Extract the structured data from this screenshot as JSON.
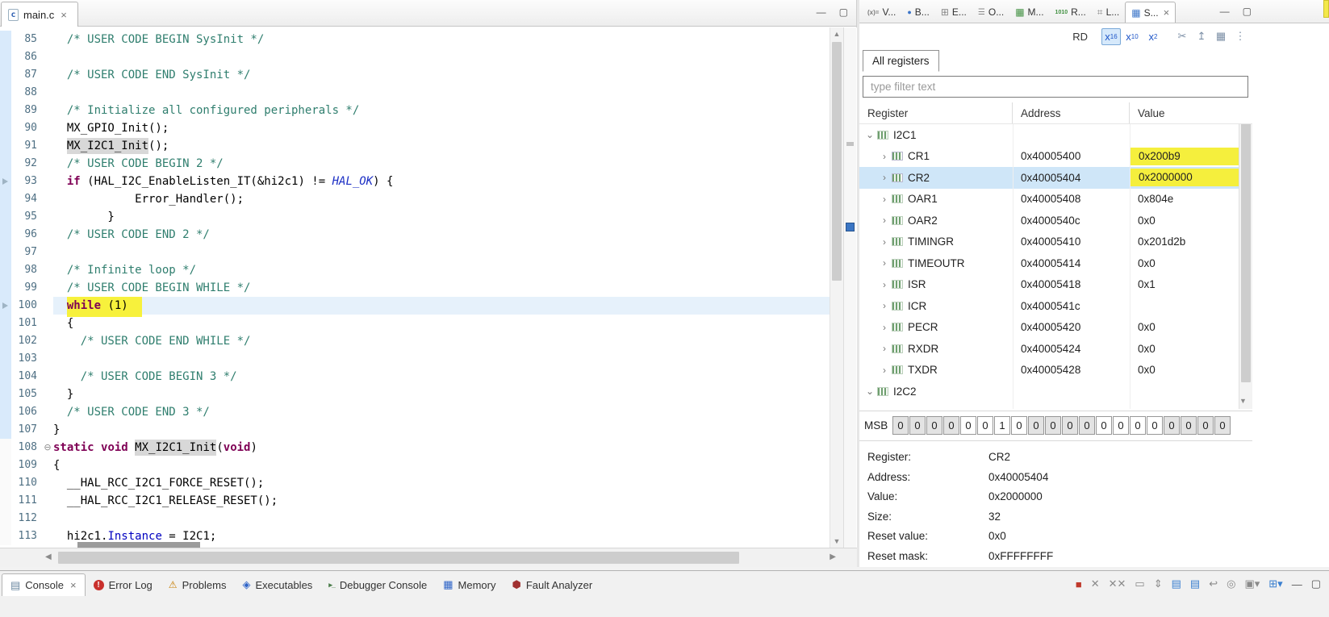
{
  "editor": {
    "tab_title": "main.c",
    "close_glyph": "×",
    "current_line": 100,
    "range_end_line": 107,
    "marker_lines": [
      93,
      100
    ],
    "lines": [
      {
        "n": 85,
        "segs": [
          {
            "t": "  /* USER CODE BEGIN SysInit */",
            "c": "cm"
          }
        ]
      },
      {
        "n": 86,
        "segs": []
      },
      {
        "n": 87,
        "segs": [
          {
            "t": "  /* USER CODE END SysInit */",
            "c": "cm"
          }
        ]
      },
      {
        "n": 88,
        "segs": []
      },
      {
        "n": 89,
        "segs": [
          {
            "t": "  /* Initialize all configured peripherals */",
            "c": "cm"
          }
        ]
      },
      {
        "n": 90,
        "segs": [
          {
            "t": "  MX_GPIO_Init();",
            "c": "pl"
          }
        ]
      },
      {
        "n": 91,
        "segs": [
          {
            "t": "  ",
            "c": "pl"
          },
          {
            "t": "MX_I2C1_Init",
            "c": "pl occ"
          },
          {
            "t": "();",
            "c": "pl"
          }
        ]
      },
      {
        "n": 92,
        "segs": [
          {
            "t": "  /* USER CODE BEGIN 2 */",
            "c": "cm"
          }
        ]
      },
      {
        "n": 93,
        "segs": [
          {
            "t": "  ",
            "c": "pl"
          },
          {
            "t": "if",
            "c": "kw"
          },
          {
            "t": " (HAL_I2C_EnableListen_IT(&hi2c1) != ",
            "c": "pl"
          },
          {
            "t": "HAL_OK",
            "c": "mac"
          },
          {
            "t": ") {",
            "c": "pl"
          }
        ]
      },
      {
        "n": 94,
        "segs": [
          {
            "t": "            Error_Handler();",
            "c": "pl"
          }
        ]
      },
      {
        "n": 95,
        "segs": [
          {
            "t": "        }",
            "c": "pl"
          }
        ]
      },
      {
        "n": 96,
        "segs": [
          {
            "t": "  /* USER CODE END 2 */",
            "c": "cm"
          }
        ]
      },
      {
        "n": 97,
        "segs": []
      },
      {
        "n": 98,
        "segs": [
          {
            "t": "  /* Infinite loop */",
            "c": "cm"
          }
        ]
      },
      {
        "n": 99,
        "segs": [
          {
            "t": "  /* USER CODE BEGIN WHILE */",
            "c": "cm"
          }
        ]
      },
      {
        "n": 100,
        "segs": [
          {
            "t": "  ",
            "c": "pl"
          },
          {
            "t": "while",
            "c": "kw hl"
          },
          {
            "t": " (1)  ",
            "c": "pl hl"
          }
        ]
      },
      {
        "n": 101,
        "segs": [
          {
            "t": "  {",
            "c": "pl"
          }
        ]
      },
      {
        "n": 102,
        "segs": [
          {
            "t": "    /* USER CODE END WHILE */",
            "c": "cm"
          }
        ]
      },
      {
        "n": 103,
        "segs": []
      },
      {
        "n": 104,
        "segs": [
          {
            "t": "    /* USER CODE BEGIN 3 */",
            "c": "cm"
          }
        ]
      },
      {
        "n": 105,
        "segs": [
          {
            "t": "  }",
            "c": "pl"
          }
        ]
      },
      {
        "n": 106,
        "segs": [
          {
            "t": "  /* USER CODE END 3 */",
            "c": "cm"
          }
        ]
      },
      {
        "n": 107,
        "segs": [
          {
            "t": "}",
            "c": "pl"
          }
        ]
      },
      {
        "n": 108,
        "fold": true,
        "segs": [
          {
            "t": "static",
            "c": "kw"
          },
          {
            "t": " ",
            "c": "pl"
          },
          {
            "t": "void",
            "c": "kw"
          },
          {
            "t": " ",
            "c": "pl"
          },
          {
            "t": "MX_I2C1_Init",
            "c": "pl occ"
          },
          {
            "t": "(",
            "c": "pl"
          },
          {
            "t": "void",
            "c": "kw"
          },
          {
            "t": ")",
            "c": "pl"
          }
        ]
      },
      {
        "n": 109,
        "segs": [
          {
            "t": "{",
            "c": "pl"
          }
        ]
      },
      {
        "n": 110,
        "segs": [
          {
            "t": "  __HAL_RCC_I2C1_FORCE_RESET();",
            "c": "pl"
          }
        ]
      },
      {
        "n": 111,
        "segs": [
          {
            "t": "  __HAL_RCC_I2C1_RELEASE_RESET();",
            "c": "pl"
          }
        ]
      },
      {
        "n": 112,
        "segs": []
      },
      {
        "n": 113,
        "segs": [
          {
            "t": "  hi2c1.",
            "c": "pl"
          },
          {
            "t": "Instance",
            "c": "fld"
          },
          {
            "t": " = I2C1;",
            "c": "pl"
          }
        ]
      }
    ]
  },
  "registers_panel": {
    "tabs": [
      {
        "label": "V...",
        "icon": "variables"
      },
      {
        "label": "B...",
        "icon": "breakpoints"
      },
      {
        "label": "E...",
        "icon": "expressions"
      },
      {
        "label": "O...",
        "icon": "outline"
      },
      {
        "label": "M...",
        "icon": "modules"
      },
      {
        "label": "R...",
        "icon": "registers"
      },
      {
        "label": "L...",
        "icon": "live-expressions"
      },
      {
        "label": "S...",
        "icon": "sfrs",
        "active": true,
        "close": "×"
      }
    ],
    "toolbar": {
      "access_label": "RD",
      "radix": [
        {
          "base": "16",
          "active": true
        },
        {
          "base": "10",
          "active": false
        },
        {
          "base": "2",
          "active": false
        }
      ],
      "icons": [
        {
          "name": "cut"
        },
        {
          "name": "export"
        },
        {
          "name": "layout"
        },
        {
          "name": "view-menu"
        }
      ]
    },
    "category_tab": "All registers",
    "filter_placeholder": "type filter text",
    "table": {
      "columns": [
        "Register",
        "Address",
        "Value"
      ],
      "rows": [
        {
          "group": true,
          "name": "I2C1",
          "expanded": true
        },
        {
          "name": "CR1",
          "addr": "0x40005400",
          "value": "0x200b9",
          "value_highlight": true,
          "rw": true
        },
        {
          "name": "CR2",
          "addr": "0x40005404",
          "value": "0x2000000",
          "value_highlight": true,
          "rw": true,
          "selected": true
        },
        {
          "name": "OAR1",
          "addr": "0x40005408",
          "value": "0x804e"
        },
        {
          "name": "OAR2",
          "addr": "0x4000540c",
          "value": "0x0"
        },
        {
          "name": "TIMINGR",
          "addr": "0x40005410",
          "value": "0x201d2b"
        },
        {
          "name": "TIMEOUTR",
          "addr": "0x40005414",
          "value": "0x0"
        },
        {
          "name": "ISR",
          "addr": "0x40005418",
          "value": "0x1"
        },
        {
          "name": "ICR",
          "addr": "0x4000541c",
          "value": ""
        },
        {
          "name": "PECR",
          "addr": "0x40005420",
          "value": "0x0"
        },
        {
          "name": "RXDR",
          "addr": "0x40005424",
          "value": "0x0"
        },
        {
          "name": "TXDR",
          "addr": "0x40005428",
          "value": "0x0"
        },
        {
          "group": true,
          "name": "I2C2",
          "expanded": true
        }
      ]
    },
    "bits": {
      "label": "MSB",
      "values": [
        0,
        0,
        0,
        0,
        0,
        0,
        1,
        0,
        0,
        0,
        0,
        0,
        0,
        0,
        0,
        0,
        0,
        0,
        0,
        0
      ]
    },
    "details": [
      {
        "label": "Register:",
        "value": "CR2"
      },
      {
        "label": "Address:",
        "value": "0x40005404"
      },
      {
        "label": "Value:",
        "value": "0x2000000"
      },
      {
        "label": "Size:",
        "value": "32"
      },
      {
        "label": "Reset value:",
        "value": "0x0"
      },
      {
        "label": "Reset mask:",
        "value": "0xFFFFFFFF"
      }
    ]
  },
  "bottom_bar": {
    "tabs": [
      {
        "label": "Console",
        "icon": "console",
        "active": true,
        "close": "×"
      },
      {
        "label": "Error Log",
        "icon": "error-log"
      },
      {
        "label": "Problems",
        "icon": "problems"
      },
      {
        "label": "Executables",
        "icon": "executables"
      },
      {
        "label": "Debugger Console",
        "icon": "debugger-console"
      },
      {
        "label": "Memory",
        "icon": "memory"
      },
      {
        "label": "Fault Analyzer",
        "icon": "fault-analyzer"
      }
    ],
    "icons": [
      {
        "name": "terminate"
      },
      {
        "name": "remove-launch"
      },
      {
        "name": "remove-all-launches"
      },
      {
        "name": "clear-console"
      },
      {
        "name": "scroll-lock"
      },
      {
        "name": "show-stdout"
      },
      {
        "name": "show-stderr"
      },
      {
        "name": "word-wrap"
      },
      {
        "name": "pin-console"
      },
      {
        "name": "display-console"
      },
      {
        "name": "open-console"
      },
      {
        "name": "minimize"
      },
      {
        "name": "maximize"
      }
    ]
  },
  "icon_glyphs": {
    "variables": "(x)=",
    "breakpoints": "●",
    "expressions": "⊞",
    "outline": "☰",
    "modules": "▦",
    "registers": "1010",
    "live-expressions": "⌗",
    "sfrs": "▦",
    "console": "▤",
    "error-log": "!",
    "problems": "⚠",
    "executables": "◈",
    "debugger-console": "▸_",
    "memory": "▦",
    "fault-analyzer": "⬢",
    "cut": "✂",
    "export": "↥",
    "layout": "▦",
    "view-menu": "⋮",
    "terminate": "■",
    "remove-launch": "✕",
    "remove-all-launches": "✕✕",
    "clear-console": "▭",
    "scroll-lock": "⇕",
    "show-stdout": "▤",
    "show-stderr": "▤",
    "word-wrap": "↩",
    "pin-console": "◎",
    "display-console": "▣▾",
    "open-console": "⊞▾",
    "minimize": "—",
    "maximize": "▢",
    "chevron-down": "⌄",
    "chevron-right": "›",
    "fold-minus": "⊖",
    "scroll-up": "▲",
    "scroll-down": "▼",
    "scroll-left": "◀",
    "scroll-right": "▶"
  },
  "colors": {
    "value_highlight": "#f5ef3d",
    "code_highlight": "#f7f13c",
    "current_line": "#e6f1fb",
    "selected_row": "#cfe6f8",
    "keyword": "#7f0055",
    "comment": "#2f7e6e",
    "macro": "#1b2ec4",
    "terminate_red": "#c0392b"
  }
}
